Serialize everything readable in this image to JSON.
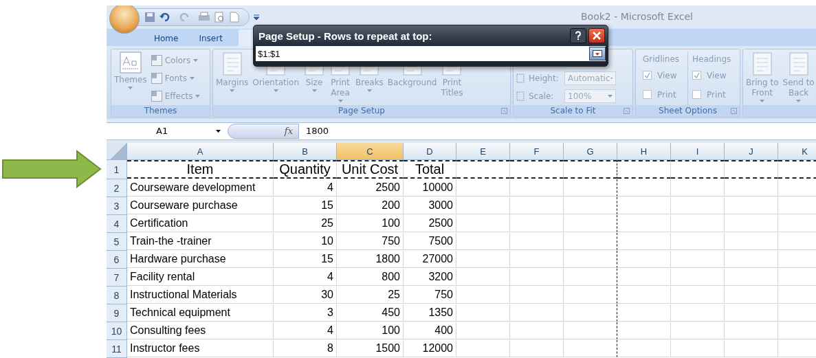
{
  "title": "Book2 - Microsoft Excel",
  "tabs": [
    {
      "label": "Home",
      "selected": false
    },
    {
      "label": "Insert",
      "selected": false
    }
  ],
  "ribbon": {
    "disabled": true,
    "groups": [
      {
        "kind": "themes",
        "label": "Themes",
        "big": "Themes",
        "items": [
          "Colors",
          "Fonts",
          "Effects"
        ]
      },
      {
        "kind": "buttons",
        "label": "Page Setup",
        "launcher": true,
        "buttons": [
          {
            "label": "Margins",
            "dropdown": true
          },
          {
            "label": "Orientation",
            "dropdown": true
          },
          {
            "label": "Size",
            "dropdown": true
          },
          {
            "label": "Print\nArea",
            "dropdown": true
          },
          {
            "label": "Breaks",
            "dropdown": true
          },
          {
            "label": "Background",
            "dropdown": false
          },
          {
            "label": "Print\nTitles",
            "dropdown": false
          }
        ]
      },
      {
        "kind": "scale",
        "label": "Scale to Fit",
        "launcher": true,
        "rows": [
          {
            "label": "Height:",
            "value": "Automatic"
          },
          {
            "label": "Scale:",
            "value": "100%"
          }
        ]
      },
      {
        "kind": "sheet_options",
        "label": "Sheet Options",
        "launcher": true,
        "columns": [
          {
            "title": "Gridlines",
            "options": [
              {
                "label": "View",
                "checked": true
              },
              {
                "label": "Print",
                "checked": false
              }
            ]
          },
          {
            "title": "Headings",
            "options": [
              {
                "label": "View",
                "checked": true
              },
              {
                "label": "Print",
                "checked": false
              }
            ]
          }
        ]
      },
      {
        "kind": "buttons",
        "launcher": false,
        "buttons": [
          {
            "label": "Bring to\nFront",
            "dropdown": true
          },
          {
            "label": "Send to\nBack",
            "dropdown": true
          }
        ]
      }
    ]
  },
  "dialog": {
    "title": "Page Setup - Rows to repeat at top:",
    "value": "$1:$1"
  },
  "name_box": "A1",
  "function_button": "fx",
  "formula": "1800",
  "columns": [
    {
      "label": "A",
      "selected": false
    },
    {
      "label": "B",
      "selected": false
    },
    {
      "label": "C",
      "selected": true
    },
    {
      "label": "D",
      "selected": false
    },
    {
      "label": "E",
      "selected": false
    },
    {
      "label": "F",
      "selected": false
    },
    {
      "label": "G",
      "selected": false,
      "page_break_after": true
    },
    {
      "label": "H",
      "selected": false
    },
    {
      "label": "I",
      "selected": false
    },
    {
      "label": "J",
      "selected": false
    },
    {
      "label": "K",
      "selected": false
    }
  ],
  "rows": [
    {
      "number": "1",
      "marquee": true,
      "cells": [
        "Item",
        "Quantity",
        "Unit Cost",
        "Total"
      ]
    },
    {
      "number": "2",
      "marquee": false,
      "cells": [
        "Courseware development",
        "4",
        "2500",
        "10000"
      ]
    },
    {
      "number": "3",
      "marquee": false,
      "cells": [
        "Courseware purchase",
        "15",
        "200",
        "3000"
      ]
    },
    {
      "number": "4",
      "marquee": false,
      "cells": [
        "Certification",
        "25",
        "100",
        "2500"
      ]
    },
    {
      "number": "5",
      "marquee": false,
      "cells": [
        "Train-the -trainer",
        "10",
        "750",
        "7500"
      ]
    },
    {
      "number": "6",
      "marquee": false,
      "cells": [
        "Hardware purchase",
        "15",
        "1800",
        "27000"
      ]
    },
    {
      "number": "7",
      "marquee": false,
      "cells": [
        "Facility rental",
        "4",
        "800",
        "3200"
      ]
    },
    {
      "number": "8",
      "marquee": false,
      "cells": [
        "Instructional Materials",
        "30",
        "25",
        "750"
      ]
    },
    {
      "number": "9",
      "marquee": false,
      "cells": [
        "Technical equipment",
        "3",
        "450",
        "1350"
      ]
    },
    {
      "number": "10",
      "marquee": false,
      "cells": [
        "Consulting fees",
        "4",
        "100",
        "400"
      ]
    },
    {
      "number": "11",
      "marquee": false,
      "cells": [
        "Instructor fees",
        "8",
        "1500",
        "12000"
      ]
    }
  ]
}
